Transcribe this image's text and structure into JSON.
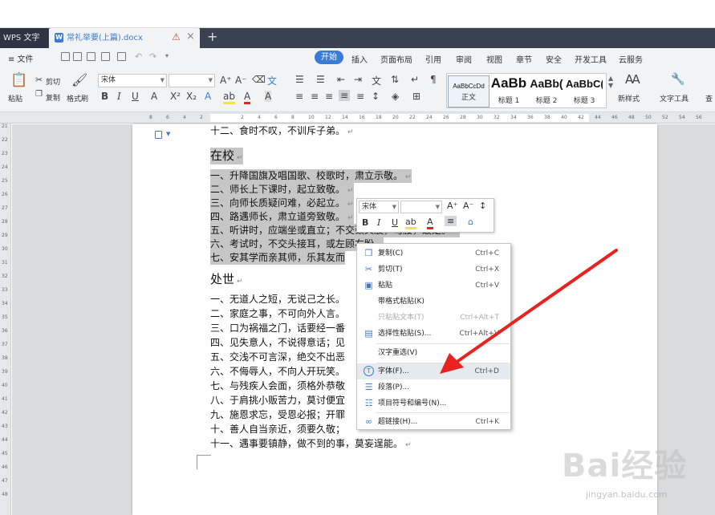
{
  "tabs": {
    "app": "WPS 文字",
    "doc_title": "常礼举要(上篇).docx",
    "new_tab": "+"
  },
  "menubar": {
    "file": "≡ 文件",
    "ribbon_tabs": [
      "开始",
      "插入",
      "页面布局",
      "引用",
      "审阅",
      "视图",
      "章节",
      "安全",
      "开发工具",
      "云服务"
    ]
  },
  "ribbon": {
    "paste": "粘贴",
    "cut": "剪切",
    "copy": "复制",
    "format_painter": "格式刷",
    "font_name": "宋体",
    "font_size": "",
    "styles": [
      {
        "preview": "AaBbCcDd",
        "label": "正文"
      },
      {
        "preview": "AaBb",
        "label": "标题 1"
      },
      {
        "preview": "AaBb(",
        "label": "标题 2"
      },
      {
        "preview": "AaBbC(",
        "label": "标题 3"
      }
    ],
    "new_style": "新样式",
    "text_tools": "文字工具",
    "find_cut": "查"
  },
  "document": {
    "line_top": "十二、食时不叹，不训斥子弟。",
    "heading1": "在校",
    "school": [
      "一、升降国旗及唱国歌、校歌时，肃立示敬。",
      "二、师长上下课时，起立致敬。",
      "三、向师长质疑问难，必起立。",
      "四、路遇师长，肃立道旁致敬。",
      "五、听讲时，应端坐或直立；不交颈父股，弯腰，跛足。",
      "六、考试时，不交头接耳，或左顾右盼。",
      "七、安其学而亲其师，乐其友而"
    ],
    "heading2": "处世",
    "world": [
      "一、无道人之短，无说己之长。",
      "二、家庭之事，不可向外人言。",
      "三、口为祸福之门，话要经一番",
      "四、见失意人，不说得意话；见",
      "五、交浅不可言深，绝交不出恶",
      "六、不侮辱人，不向人开玩笑。",
      "七、与残疾人会面，须格外恭敬",
      "八、于肩挑小贩苦力，莫讨便宜",
      "九、施恩求忘，受恩必报；开罪",
      "十、善人自当亲近，须要久敬；",
      "十一、遇事要镇静，做不到的事，莫妄逞能。"
    ]
  },
  "mini_toolbar": {
    "font_name": "宋体",
    "font_size": ""
  },
  "context_menu": [
    {
      "label": "复制(C)",
      "shortcut": "Ctrl+C",
      "icon": "copy-icon",
      "disabled": false
    },
    {
      "label": "剪切(T)",
      "shortcut": "Ctrl+X",
      "icon": "scissors-icon",
      "disabled": false
    },
    {
      "label": "粘贴",
      "shortcut": "Ctrl+V",
      "icon": "paste-icon",
      "disabled": false
    },
    {
      "label": "带格式粘贴(K)",
      "shortcut": "",
      "icon": "",
      "disabled": false
    },
    {
      "label": "只粘贴文本(T)",
      "shortcut": "Ctrl+Alt+T",
      "icon": "",
      "disabled": true
    },
    {
      "label": "选择性粘贴(S)...",
      "shortcut": "Ctrl+Alt+V",
      "icon": "paste-special-icon",
      "disabled": false
    },
    {
      "label": "汉字重选(V)",
      "shortcut": "",
      "icon": "",
      "disabled": false
    },
    {
      "label": "字体(F)...",
      "shortcut": "Ctrl+D",
      "icon": "font-icon",
      "disabled": false
    },
    {
      "label": "段落(P)...",
      "shortcut": "",
      "icon": "paragraph-icon",
      "disabled": false
    },
    {
      "label": "项目符号和编号(N)...",
      "shortcut": "",
      "icon": "list-icon",
      "disabled": false
    },
    {
      "label": "超链接(H)...",
      "shortcut": "Ctrl+K",
      "icon": "link-icon",
      "disabled": false
    }
  ],
  "watermark": {
    "brand": "Bai经验",
    "url": "jingyan.baidu.com"
  },
  "colors": {
    "accent": "#3a7bd5",
    "tabbar": "#3a4150",
    "selection": "#c6c6c6",
    "arrow": "#e8231f"
  }
}
